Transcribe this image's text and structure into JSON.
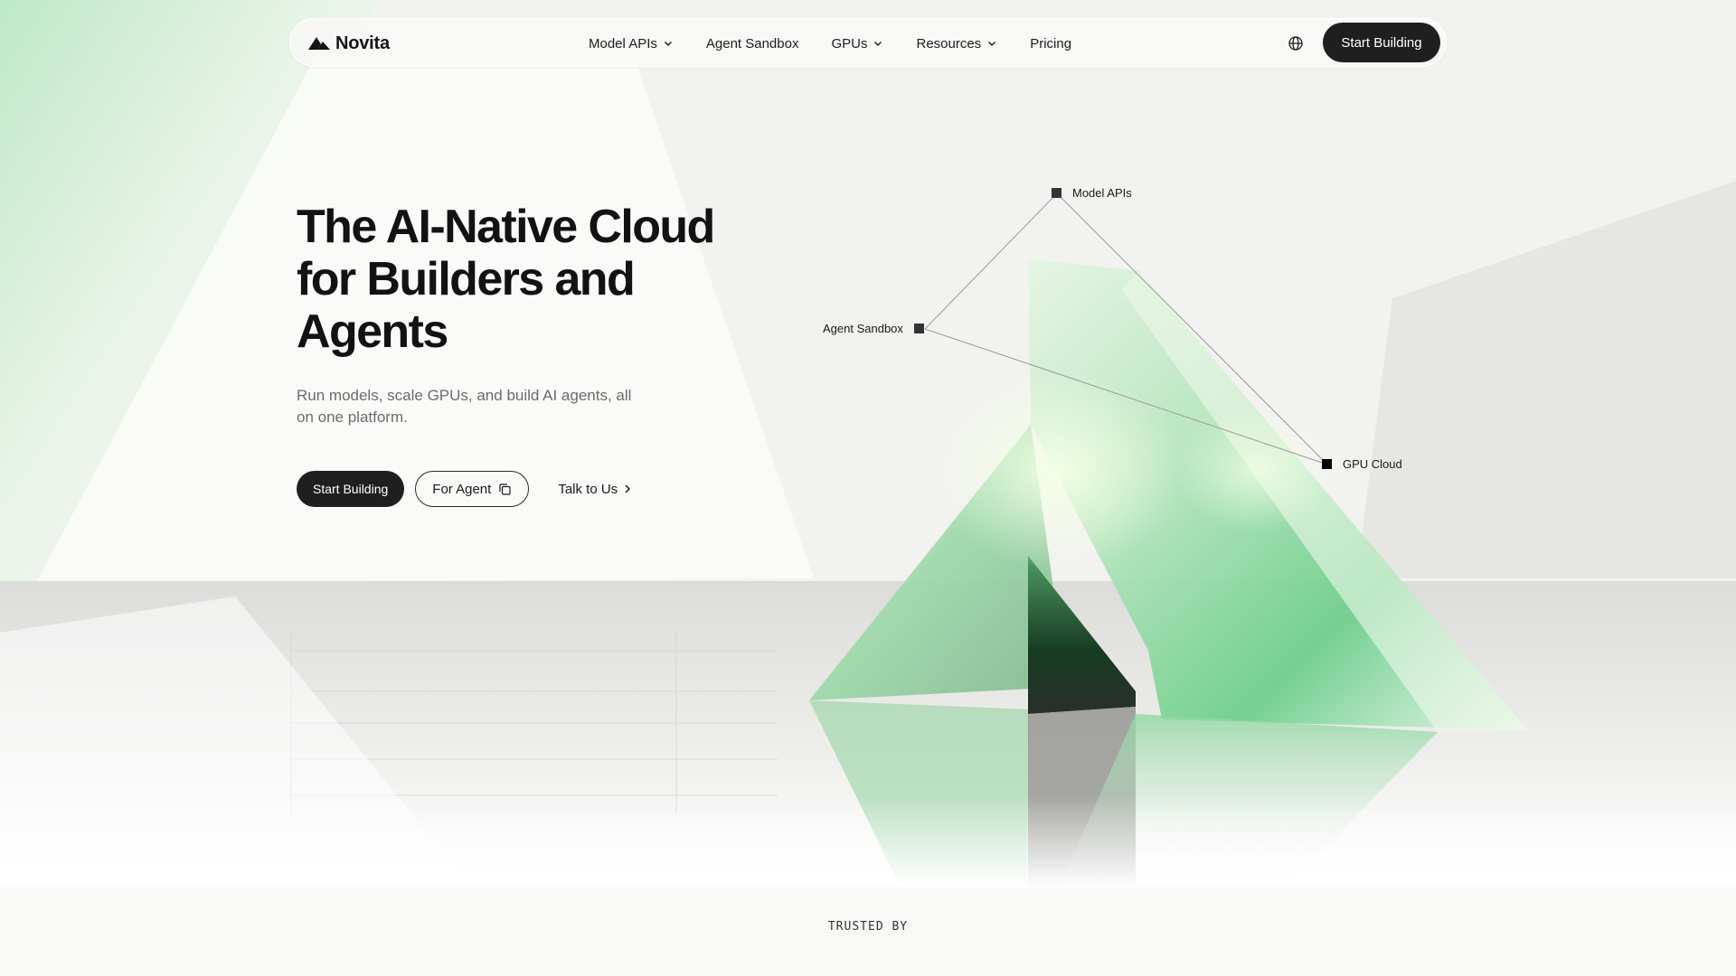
{
  "brand": {
    "name": "Novita"
  },
  "nav": {
    "links": [
      {
        "label": "Model APIs",
        "has_dropdown": true
      },
      {
        "label": "Agent Sandbox",
        "has_dropdown": false
      },
      {
        "label": "GPUs",
        "has_dropdown": true
      },
      {
        "label": "Resources",
        "has_dropdown": true
      },
      {
        "label": "Pricing",
        "has_dropdown": false
      }
    ],
    "language_icon": "globe-icon",
    "cta_label": "Start Building"
  },
  "hero": {
    "title_lines": [
      "The AI-Native Cloud",
      "for Builders and",
      "Agents"
    ],
    "subtitle_lines": [
      "Run models, scale GPUs, and build AI agents, all",
      "on one platform."
    ],
    "primary_cta": "Start Building",
    "secondary_cta": "For Agent",
    "secondary_cta_icon": "copy-icon",
    "tertiary_cta": "Talk to Us",
    "tertiary_cta_icon": "chevron-right-icon"
  },
  "diagram": {
    "nodes": {
      "model_apis": "Model APIs",
      "agent_sandbox": "Agent Sandbox",
      "gpu_cloud": "GPU Cloud"
    }
  },
  "trusted": {
    "label": "TRUSTED BY"
  },
  "colors": {
    "accent_green": "#7fd69a",
    "dark": "#1f1f1f",
    "background": "#f3f3f1"
  }
}
